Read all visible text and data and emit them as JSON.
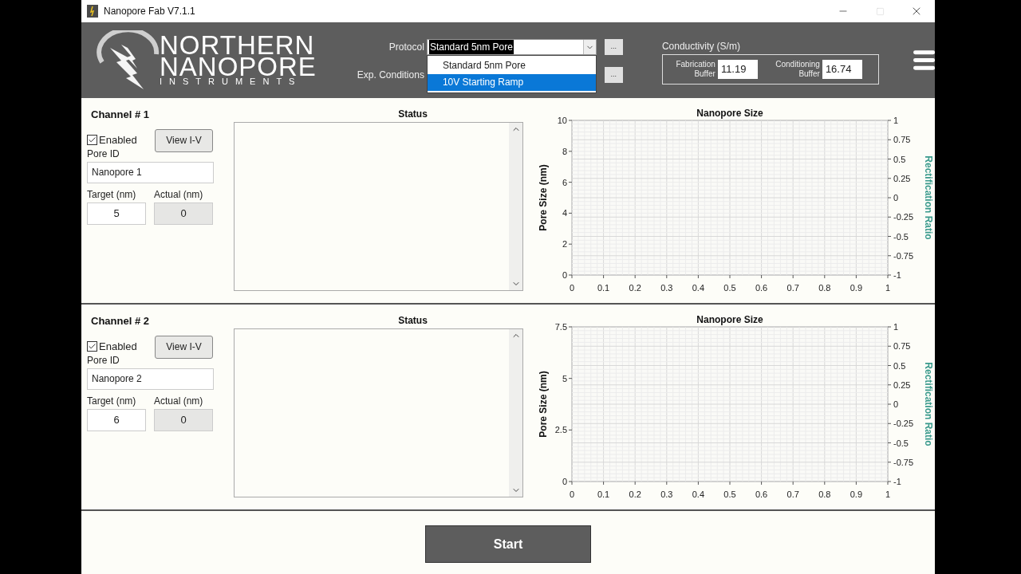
{
  "window": {
    "title": "Nanopore Fab V7.1.1"
  },
  "logo": {
    "lines": [
      "NORTHERN",
      "NANOPORE",
      "INSTRUMENTS"
    ]
  },
  "protocol": {
    "label": "Protocol",
    "value": "Standard 5nm Pore",
    "more_button": "...",
    "dropdown": {
      "expanded": true,
      "options": [
        {
          "label": "Standard 5nm Pore",
          "selected": false
        },
        {
          "label": "10V Starting Ramp",
          "selected": true
        }
      ]
    }
  },
  "exp_conditions": {
    "label": "Exp. Conditions",
    "more_button": "..."
  },
  "conductivity": {
    "title": "Conductivity (S/m)",
    "fields": [
      {
        "label": "Fabrication Buffer",
        "value": "11.19"
      },
      {
        "label": "Conditioning Buffer",
        "value": "16.74"
      }
    ]
  },
  "channels": [
    {
      "name": "Channel # 1",
      "enabled": {
        "label": "Enabled",
        "checked": true
      },
      "view_button": "View I-V",
      "pore_id_label": "Pore ID",
      "pore_id": "Nanopore 1",
      "target_label": "Target (nm)",
      "target": "5",
      "actual_label": "Actual (nm)",
      "actual": "0",
      "status_title": "Status",
      "chart_data": {
        "type": "line",
        "grid": true,
        "title": "Nanopore Size",
        "ylabel": "Pore Size (nm)",
        "xlim": [
          0,
          1
        ],
        "ylim": [
          0,
          10
        ],
        "xticks": [
          {
            "value": 0,
            "label": "0"
          },
          {
            "value": 0.1,
            "label": "0.1"
          },
          {
            "value": 0.2,
            "label": "0.2"
          },
          {
            "value": 0.3,
            "label": "0.3"
          },
          {
            "value": 0.4,
            "label": "0.4"
          },
          {
            "value": 0.5,
            "label": "0.5"
          },
          {
            "value": 0.6,
            "label": "0.6"
          },
          {
            "value": 0.7,
            "label": "0.7"
          },
          {
            "value": 0.8,
            "label": "0.8"
          },
          {
            "value": 0.9,
            "label": "0.9"
          },
          {
            "value": 1,
            "label": "1"
          }
        ],
        "yticks": [
          {
            "value": 0,
            "label": "0"
          },
          {
            "value": 2,
            "label": "2"
          },
          {
            "value": 4,
            "label": "4"
          },
          {
            "value": 6,
            "label": "6"
          },
          {
            "value": 8,
            "label": "8"
          },
          {
            "value": 10,
            "label": "10"
          }
        ]
      },
      "right_axis": {
        "label": "Rectification Ratio",
        "ticks": [
          "1",
          "0.75",
          "0.5",
          "0.25",
          "0",
          "-0.25",
          "-0.5",
          "-0.75",
          "-1"
        ]
      }
    },
    {
      "name": "Channel # 2",
      "enabled": {
        "label": "Enabled",
        "checked": true
      },
      "view_button": "View I-V",
      "pore_id_label": "Pore ID",
      "pore_id": "Nanopore 2",
      "target_label": "Target (nm)",
      "target": "6",
      "actual_label": "Actual (nm)",
      "actual": "0",
      "status_title": "Status",
      "chart_data": {
        "type": "line",
        "grid": true,
        "title": "Nanopore Size",
        "ylabel": "Pore Size (nm)",
        "xlim": [
          0,
          1
        ],
        "ylim": [
          0,
          7.5
        ],
        "xticks": [
          {
            "value": 0,
            "label": "0"
          },
          {
            "value": 0.1,
            "label": "0.1"
          },
          {
            "value": 0.2,
            "label": "0.2"
          },
          {
            "value": 0.3,
            "label": "0.3"
          },
          {
            "value": 0.4,
            "label": "0.4"
          },
          {
            "value": 0.5,
            "label": "0.5"
          },
          {
            "value": 0.6,
            "label": "0.6"
          },
          {
            "value": 0.7,
            "label": "0.7"
          },
          {
            "value": 0.8,
            "label": "0.8"
          },
          {
            "value": 0.9,
            "label": "0.9"
          },
          {
            "value": 1,
            "label": "1"
          }
        ],
        "yticks": [
          {
            "value": 0,
            "label": "0"
          },
          {
            "value": 2.5,
            "label": "2.5"
          },
          {
            "value": 5,
            "label": "5"
          },
          {
            "value": 7.5,
            "label": "7.5"
          }
        ]
      },
      "right_axis": {
        "label": "Rectification Ratio",
        "ticks": [
          "1",
          "0.75",
          "0.5",
          "0.25",
          "0",
          "-0.25",
          "-0.5",
          "-0.75",
          "-1"
        ]
      }
    }
  ],
  "start_button": "Start"
}
